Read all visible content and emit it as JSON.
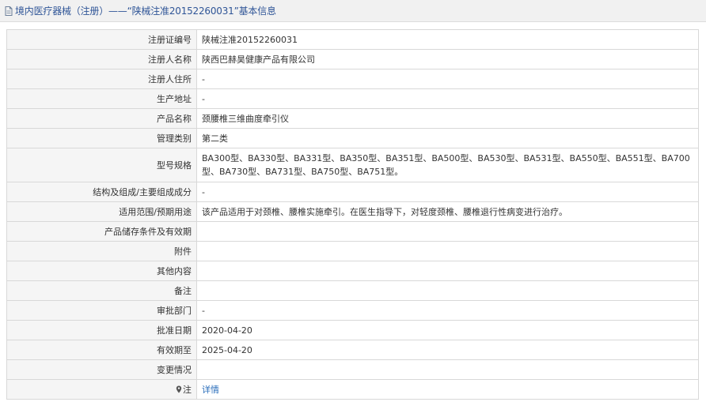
{
  "header": {
    "title": "境内医疗器械（注册）——“陕械注准20152260031”基本信息"
  },
  "rows": [
    {
      "label": "注册证编号",
      "value": "陕械注准20152260031"
    },
    {
      "label": "注册人名称",
      "value": "陕西巴赫昊健康产品有限公司"
    },
    {
      "label": "注册人住所",
      "value": "-"
    },
    {
      "label": "生产地址",
      "value": "-"
    },
    {
      "label": "产品名称",
      "value": "颈腰椎三维曲度牵引仪"
    },
    {
      "label": "管理类别",
      "value": "第二类"
    },
    {
      "label": "型号规格",
      "value": "BA300型、BA330型、BA331型、BA350型、BA351型、BA500型、BA530型、BA531型、BA550型、BA551型、BA700型、BA730型、BA731型、BA750型、BA751型。"
    },
    {
      "label": "结构及组成/主要组成成分",
      "value": "-"
    },
    {
      "label": "适用范围/预期用途",
      "value": "该产品适用于对颈椎、腰椎实施牵引。在医生指导下，对轻度颈椎、腰椎退行性病变进行治疗。"
    },
    {
      "label": "产品储存条件及有效期",
      "value": ""
    },
    {
      "label": "附件",
      "value": ""
    },
    {
      "label": "其他内容",
      "value": ""
    },
    {
      "label": "备注",
      "value": ""
    },
    {
      "label": "审批部门",
      "value": "-"
    },
    {
      "label": "批准日期",
      "value": "2020-04-20"
    },
    {
      "label": "有效期至",
      "value": "2025-04-20"
    },
    {
      "label": "变更情况",
      "value": ""
    }
  ],
  "note": {
    "label": "注",
    "link": "详情"
  },
  "colors": {
    "header_bg": "#f1f1f1",
    "header_text": "#2f5597",
    "label_bg": "#f5f5f5",
    "border": "#d8d8d8",
    "link": "#2a6ebb"
  }
}
